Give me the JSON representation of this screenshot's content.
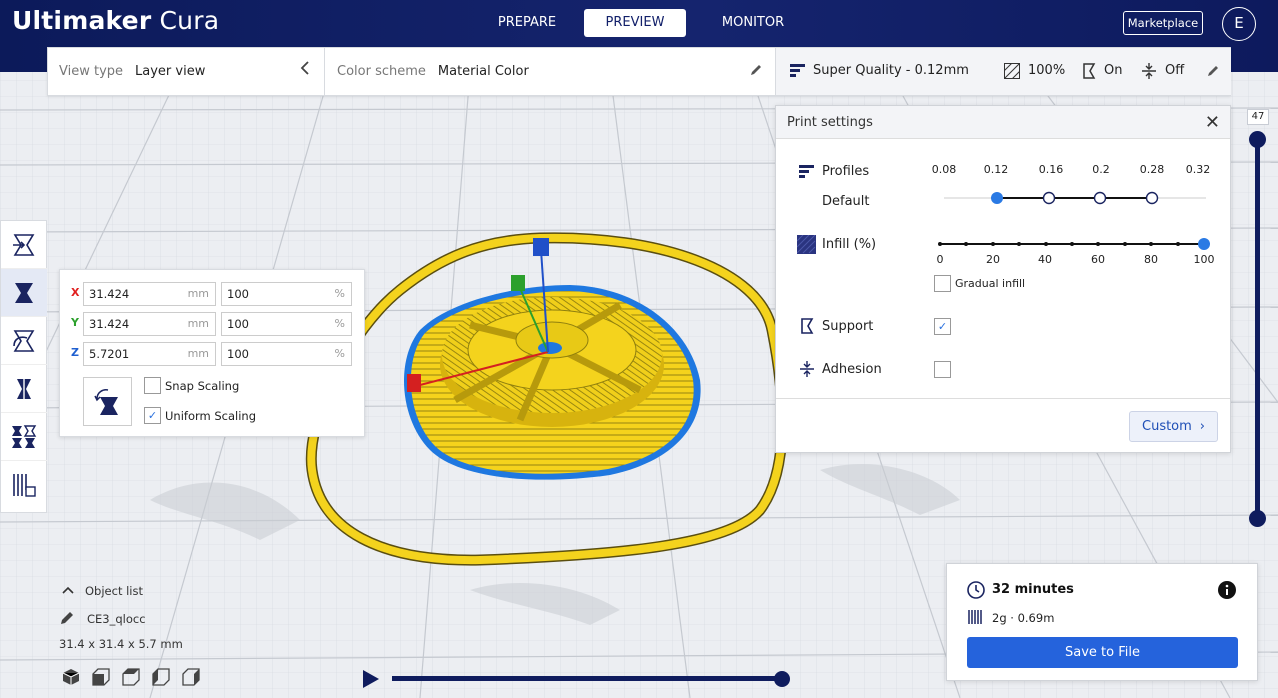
{
  "app": {
    "brand_bold": "Ultimaker",
    "brand_light": "Cura"
  },
  "stages": [
    "PREPARE",
    "PREVIEW",
    "MONITOR"
  ],
  "active_stage": "PREVIEW",
  "header_right": {
    "marketplace": "Marketplace",
    "account_initial": "E"
  },
  "view_bar": {
    "view_type_label": "View type",
    "view_type_value": "Layer view",
    "color_scheme_label": "Color scheme",
    "color_scheme_value": "Material Color",
    "quality": "Super Quality - 0.12mm",
    "infill": "100%",
    "support": "On",
    "adhesion": "Off"
  },
  "scale_panel": {
    "rows": [
      {
        "axis": "X",
        "color": "#e02020",
        "mm": "31.424",
        "percent": "100"
      },
      {
        "axis": "Y",
        "color": "#2ca02c",
        "mm": "31.424",
        "percent": "100"
      },
      {
        "axis": "Z",
        "color": "#2060d0",
        "mm": "5.7201",
        "percent": "100"
      }
    ],
    "unit_mm": "mm",
    "unit_pct": "%",
    "snap_scaling": "Snap Scaling",
    "snap_checked": false,
    "uniform_scaling": "Uniform Scaling",
    "uniform_checked": true
  },
  "print_settings": {
    "title": "Print settings",
    "profiles_label": "Profiles",
    "profile_default": "Default",
    "profile_ticks": [
      "0.08",
      "0.12",
      "0.16",
      "0.2",
      "0.28",
      "0.32"
    ],
    "selected_profile": "0.12",
    "infill_label": "Infill (%)",
    "infill_ticks": [
      "0",
      "20",
      "40",
      "60",
      "80",
      "100"
    ],
    "infill_value": 100,
    "gradual_infill": "Gradual infill",
    "gradual_checked": false,
    "support_label": "Support",
    "support_checked": true,
    "adhesion_label": "Adhesion",
    "adhesion_checked": false,
    "custom_button": "Custom"
  },
  "layer_slider": {
    "current_layer": "47"
  },
  "object_list": {
    "title": "Object list",
    "object_name": "CE3_qlocc",
    "dimensions": "31.4 x 31.4 x 5.7 mm"
  },
  "estimate": {
    "time": "32 minutes",
    "material": "2g · 0.69m",
    "save_button": "Save to File"
  },
  "colors": {
    "header_bg": "#13216a",
    "accent_blue": "#2563dc",
    "model_yellow": "#f2d21a",
    "outline_blue": "#1f78e0"
  }
}
